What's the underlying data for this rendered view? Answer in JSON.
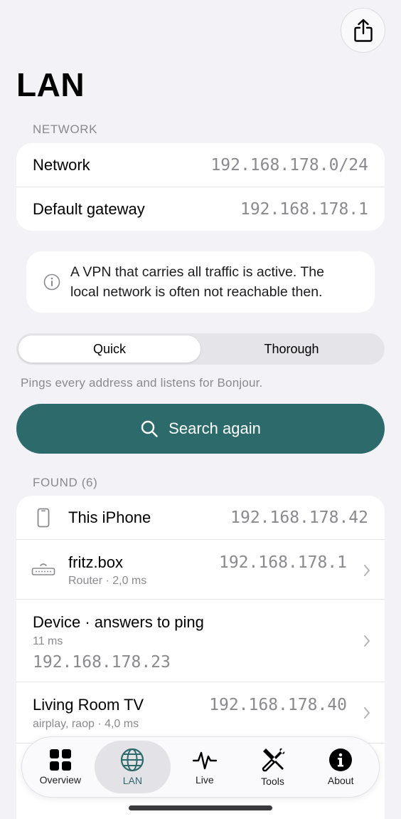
{
  "page": {
    "title": "LAN"
  },
  "network_section": {
    "header": "NETWORK",
    "rows": [
      {
        "label": "Network",
        "value": "192.168.178.0/24"
      },
      {
        "label": "Default gateway",
        "value": "192.168.178.1"
      }
    ]
  },
  "vpn_notice": {
    "line1": "A VPN that carries all traffic is active. The",
    "line2": "local network is often not reachable then."
  },
  "scan_mode": {
    "options": [
      "Quick",
      "Thorough"
    ],
    "selected": "Quick",
    "description": "Pings every address and listens for Bonjour."
  },
  "search_button": {
    "label": "Search again"
  },
  "found_section": {
    "header": "FOUND (6)",
    "devices": [
      {
        "name": "This iPhone",
        "ip": "192.168.178.42",
        "icon": "phone-icon"
      },
      {
        "name": "fritz.box",
        "detail": "Router · 2,0 ms",
        "ip": "192.168.178.1",
        "icon": "router-icon"
      },
      {
        "name": "Device · answers to ping",
        "detail": "11 ms",
        "ip": "192.168.178.23"
      },
      {
        "name": "Living Room TV",
        "detail": "airplay, raop · 4,0 ms",
        "ip": "192.168.178.40"
      }
    ]
  },
  "tabbar": {
    "tabs": [
      {
        "label": "Overview",
        "icon": "grid-icon"
      },
      {
        "label": "LAN",
        "icon": "globe-icon"
      },
      {
        "label": "Live",
        "icon": "waveform-icon"
      },
      {
        "label": "Tools",
        "icon": "tools-icon"
      },
      {
        "label": "About",
        "icon": "info-icon"
      }
    ],
    "selected": "LAN"
  },
  "colors": {
    "accent": "#2c6a6c",
    "background": "#f2f2f7",
    "secondary_text": "#8a8a8e"
  }
}
